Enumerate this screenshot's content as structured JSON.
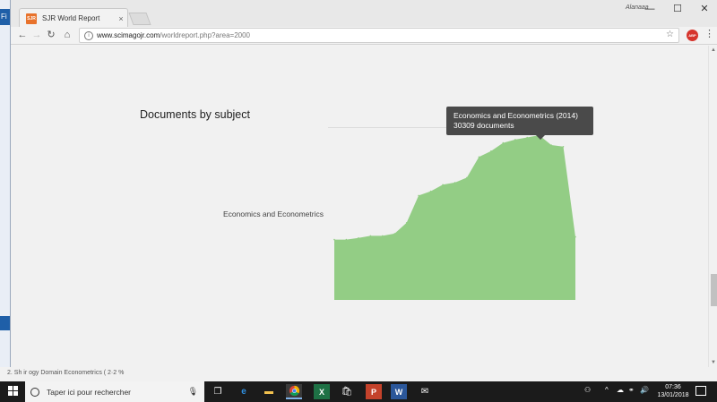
{
  "background": {
    "left_label": "Fi",
    "bottom_text": "2. Sh ir ogy        Domain Econometrics ( 2·2 %"
  },
  "browser": {
    "tab_title": "SJR World Report",
    "tab_favicon_text": "SJR",
    "tab_close": "×",
    "profile_name": "Alanaaa",
    "url_host": "www.scimagojr.com",
    "url_path": "/worldreport.php?area=2000",
    "extension_label": "ABP",
    "controls": {
      "minimize": "—",
      "maximize": "☐",
      "close": "✕"
    }
  },
  "page": {
    "section_title": "Documents by subject",
    "category_label": "Economics and Econometrics",
    "tooltip": {
      "line1": "Economics and Econometrics (2014)",
      "line2": "30309 documents"
    }
  },
  "chart_data": {
    "type": "area",
    "series": [
      {
        "values": [
          11100,
          11100,
          11400,
          11800,
          11800,
          12200,
          14200,
          19200,
          20000,
          21200,
          21600,
          22500,
          26300,
          27400,
          28900,
          29500,
          29900,
          30309,
          28500,
          28200,
          11600
        ]
      }
    ],
    "ylim": [
      0,
      30309
    ],
    "color": "#93cd85",
    "grid": false,
    "highlight_index": 17
  },
  "taskbar": {
    "search_placeholder": "Taper ici pour rechercher",
    "time": "07:36",
    "date": "13/01/2018"
  }
}
